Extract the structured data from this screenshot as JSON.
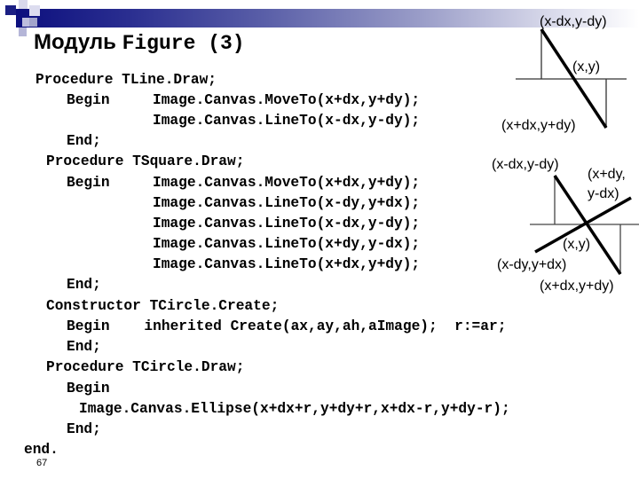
{
  "slide": {
    "title_prefix": "Модуль",
    "title_code": "Figure (3)",
    "page_number": "67",
    "colors": {
      "banner_dark": "#0c0f7e",
      "banner_light": "#ffffff",
      "text": "#000000"
    }
  },
  "code_lines": [
    "Procedure TLine.Draw;",
    "Begin   Image.Canvas.MoveTo(x+dx,y+dy);",
    "Image.Canvas.LineTo(x-dx,y-dy);",
    "End;",
    "Procedure TSquare.Draw;",
    "Begin   Image.Canvas.MoveTo(x+dx,y+dy);",
    "Image.Canvas.LineTo(x-dy,y+dx);",
    "Image.Canvas.LineTo(x-dx,y-dy);",
    "Image.Canvas.LineTo(x+dy,y-dx);",
    "Image.Canvas.LineTo(x+dx,y+dy);",
    "End;",
    "Constructor TCircle.Create;",
    "Begin    inherited Create(ax,ay,ah,aImage);  r:=ar;",
    "End;",
    "Procedure TCircle.Draw;",
    "Begin",
    "Image.Canvas.Ellipse(x+dx+r,y+dy+r,x+dx-r,y+dy-r);",
    "End;",
    "end."
  ],
  "diagrams": {
    "line": {
      "labels": {
        "start": "(x-dx,y-dy)",
        "center": "(x,y)",
        "end": "(x+dx,y+dy)"
      }
    },
    "square": {
      "labels": {
        "top_left": "(x-dx,y-dy)",
        "top_right_1": "(x+dy,",
        "top_right_2": "y-dx)",
        "center": "(x,y)",
        "bottom_left": "(x-dy,y+dx)",
        "bottom_right": "(x+dx,y+dy)"
      }
    }
  }
}
